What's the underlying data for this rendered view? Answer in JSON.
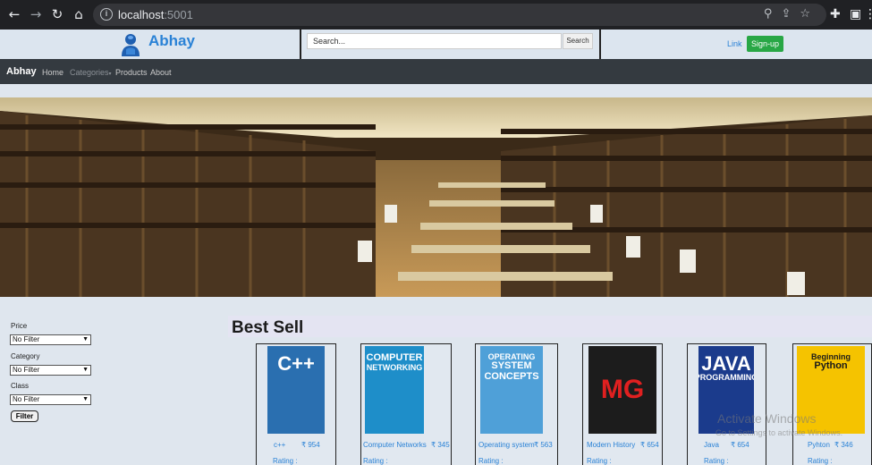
{
  "browser": {
    "url_host": "localhost",
    "url_port": ":5001",
    "icons": [
      "back-icon",
      "forward-icon",
      "reload-icon",
      "home-icon",
      "info-icon",
      "zoom-icon",
      "share-icon",
      "star-icon",
      "extensions-icon",
      "sidebar-icon",
      "menu-icon"
    ]
  },
  "header": {
    "brand": "Abhay",
    "search_placeholder": "Search...",
    "search_button": "Search",
    "link": "Link",
    "signup": "Sign-up"
  },
  "navbar": {
    "brand": "Abhay",
    "items": [
      "Home",
      "Categories",
      "Products",
      "About"
    ]
  },
  "filters": {
    "price_label": "Price",
    "price_value": "No Filter",
    "category_label": "Category",
    "category_value": "No Filter",
    "class_label": "Class",
    "class_value": "No Filter",
    "button": "Filter"
  },
  "best_sell": {
    "title": "Best Sell",
    "products": [
      {
        "name": "c++",
        "price": "₹ 954",
        "rating": "Rating :",
        "cover": {
          "bg": "#2a6fb0",
          "lines": [
            "C++"
          ]
        }
      },
      {
        "name": "Computer Networks",
        "price": "₹ 345",
        "rating": "Rating :",
        "cover": {
          "bg": "#1e8ec9",
          "lines": [
            "COMPUTER",
            "NETWORKING"
          ]
        }
      },
      {
        "name": "Operating system",
        "price": "₹ 563",
        "rating": "Rating :",
        "cover": {
          "bg": "#4fa0d8",
          "lines": [
            "OPERATING",
            "SYSTEM",
            "CONCEPTS"
          ]
        }
      },
      {
        "name": "Modern History",
        "price": "₹ 654",
        "rating": "Rating :",
        "cover": {
          "bg": "#1c1c1c",
          "lines": [
            "MG"
          ]
        }
      },
      {
        "name": "Java",
        "price": "₹ 654",
        "rating": "Rating :",
        "cover": {
          "bg": "#1b3b8c",
          "lines": [
            "JAVA",
            "PROGRAMMING"
          ]
        }
      },
      {
        "name": "Pyhton",
        "price": "₹ 346",
        "rating": "Rating :",
        "cover": {
          "bg": "#f5c300",
          "lines": [
            "Beginning",
            "Python"
          ]
        }
      }
    ]
  },
  "watermark": {
    "line1": "Activate Windows",
    "line2": "Go to Settings to activate Windows."
  }
}
